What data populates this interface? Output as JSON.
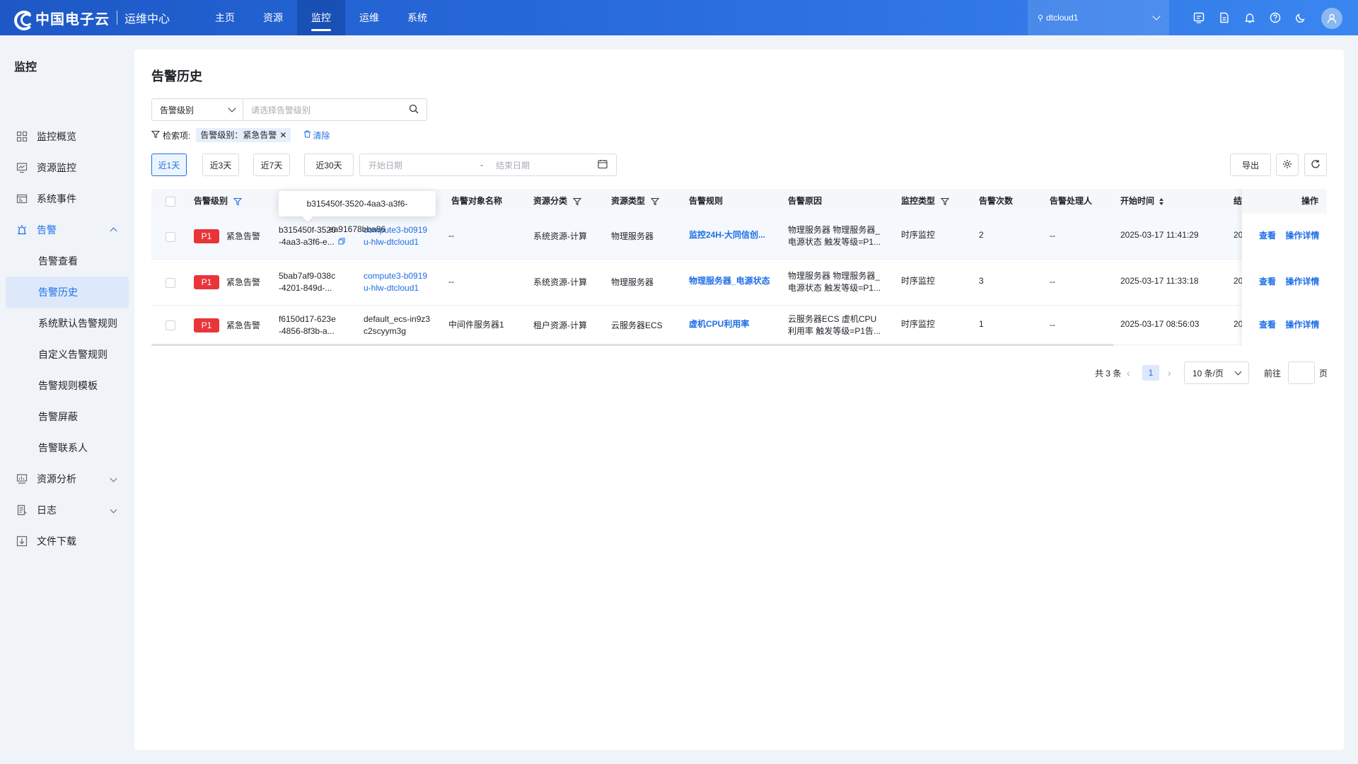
{
  "header": {
    "brand": "中国电子云",
    "subtitle": "运维中心",
    "nav": [
      "主页",
      "资源",
      "监控",
      "运维",
      "系统"
    ],
    "active_nav": "监控",
    "region": "dtcloud1",
    "icons": [
      "console-icon",
      "document-icon",
      "bell-icon",
      "help-icon",
      "moon-icon",
      "user-avatar-icon"
    ]
  },
  "sidebar": {
    "title": "监控",
    "items": [
      {
        "label": "监控概览",
        "icon": "dashboard-icon"
      },
      {
        "label": "资源监控",
        "icon": "monitor-chart-icon"
      },
      {
        "label": "系统事件",
        "icon": "event-icon"
      },
      {
        "label": "告警",
        "icon": "alarm-icon"
      },
      {
        "label": "资源分析",
        "icon": "analysis-icon"
      },
      {
        "label": "日志",
        "icon": "log-icon"
      },
      {
        "label": "文件下载",
        "icon": "download-icon"
      }
    ],
    "alarm_sub": [
      "告警查看",
      "告警历史",
      "系统默认告警规则",
      "自定义告警规则",
      "告警规则模板",
      "告警屏蔽",
      "告警联系人"
    ],
    "active_sub": "告警历史"
  },
  "page": {
    "title": "告警历史",
    "filter_field": "告警级别",
    "filter_placeholder": "请选择告警级别",
    "criteria_label": "检索项:",
    "criteria_tag": "告警级别：紧急告警",
    "clear_label": "清除",
    "ranges": [
      "近1天",
      "近3天",
      "近7天",
      "近30天"
    ],
    "active_range": "近1天",
    "start_placeholder": "开始日期",
    "date_sep": "-",
    "end_placeholder": "结束日期",
    "export_label": "导出"
  },
  "table": {
    "headers": {
      "level": "告警级别",
      "object_id": "",
      "object_name": "告警对象名称",
      "res_category": "资源分类",
      "res_type": "资源类型",
      "rule": "告警规则",
      "reason": "告警原因",
      "monitor_type": "监控类型",
      "count": "告警次数",
      "handler": "告警处理人",
      "start_time": "开始时间",
      "end_time": "结",
      "actions": "操作"
    },
    "tooltip": "b315450f-3520-4aa3-a3f6-ea91678bba86",
    "rows": [
      {
        "badge": "P1",
        "level": "紧急告警",
        "id_line1": "b315450f-3520",
        "id_line2": "-4aa3-a3f6-e...",
        "obj_line1": "compute3-b0919",
        "obj_line2": "u-hlw-dtcloud1",
        "obj_name": "--",
        "res_category": "系统资源-计算",
        "res_type": "物理服务器",
        "rule": "监控24H-大同信创...",
        "reason_line1": "物理服务器 物理服务器_",
        "reason_line2": "电源状态 触发等级=P1...",
        "monitor_type": "时序监控",
        "count": "2",
        "handler": "--",
        "start_time": "2025-03-17 11:41:29",
        "end_time_clip": "20",
        "view": "查看",
        "detail": "操作详情"
      },
      {
        "badge": "P1",
        "level": "紧急告警",
        "id_line1": "5bab7af9-038c",
        "id_line2": "-4201-849d-...",
        "obj_line1": "compute3-b0919",
        "obj_line2": "u-hlw-dtcloud1",
        "obj_name": "--",
        "res_category": "系统资源-计算",
        "res_type": "物理服务器",
        "rule": "物理服务器_电源状态",
        "reason_line1": "物理服务器 物理服务器_",
        "reason_line2": "电源状态 触发等级=P1...",
        "monitor_type": "时序监控",
        "count": "3",
        "handler": "--",
        "start_time": "2025-03-17 11:33:18",
        "end_time_clip": "20",
        "view": "查看",
        "detail": "操作详情"
      },
      {
        "badge": "P1",
        "level": "紧急告警",
        "id_line1": "f6150d17-623e",
        "id_line2": "-4856-8f3b-a...",
        "obj_line1": "default_ecs-in9z3",
        "obj_line2": "c2scyym3g",
        "obj_name": "中间件服务器1",
        "res_category": "租户资源-计算",
        "res_type": "云服务器ECS",
        "rule": "虚机CPU利用率",
        "reason_line1": "云服务器ECS 虚机CPU",
        "reason_line2": "利用率 触发等级=P1告...",
        "monitor_type": "时序监控",
        "count": "1",
        "handler": "--",
        "start_time": "2025-03-17 08:56:03",
        "end_time_clip": "20",
        "view": "查看",
        "detail": "操作详情"
      }
    ]
  },
  "pagination": {
    "total": "共 3 条",
    "prev": "‹",
    "current": "1",
    "next": "›",
    "page_size": "10 条/页",
    "goto_label": "前往",
    "goto_unit": "页"
  },
  "colors": {
    "primary": "#1e6fe6",
    "p1_badge": "#e8353a",
    "active_bg": "#dde8fa"
  }
}
